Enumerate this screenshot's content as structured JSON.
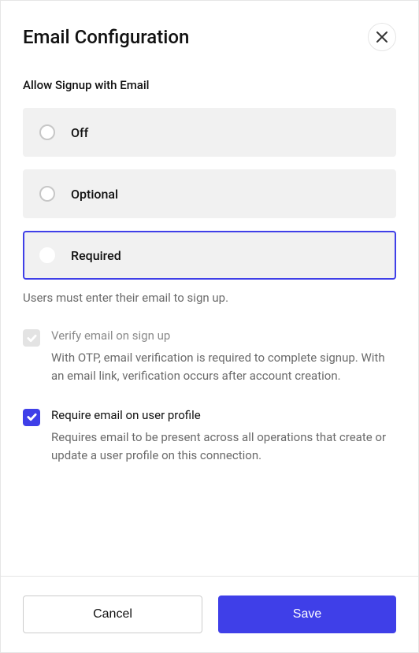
{
  "dialog": {
    "title": "Email Configuration"
  },
  "section": {
    "label": "Allow Signup with Email"
  },
  "radioOptions": {
    "off": "Off",
    "optional": "Optional",
    "required": "Required"
  },
  "helpText": "Users must enter their email to sign up.",
  "checkboxes": {
    "verify": {
      "label": "Verify email on sign up",
      "description": "With OTP, email verification is required to complete signup. With an email link, verification occurs after account creation."
    },
    "require": {
      "label": "Require email on user profile",
      "description": "Requires email to be present across all operations that create or update a user profile on this connection."
    }
  },
  "buttons": {
    "cancel": "Cancel",
    "save": "Save"
  }
}
